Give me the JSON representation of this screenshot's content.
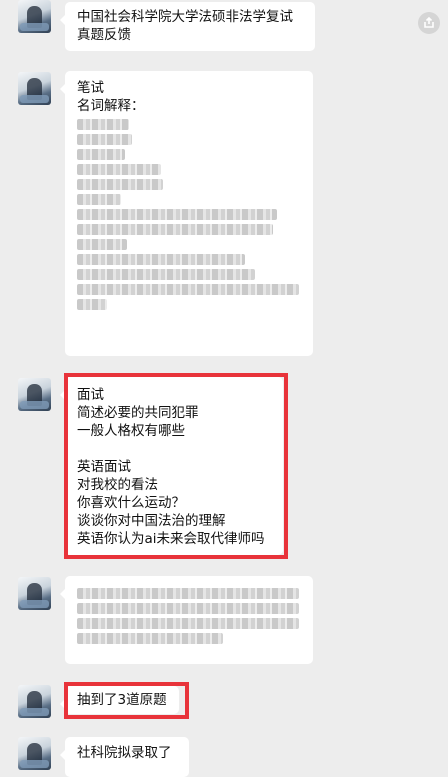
{
  "messages": [
    {
      "lines": [
        "中国社会科学院大学法硕非法学复试",
        "真题反馈"
      ]
    },
    {
      "lines": [
        "笔试",
        "名词解释："
      ]
    },
    {
      "lines": [
        "面试",
        "简述必要的共同犯罪",
        "一般人格权有哪些",
        "",
        "英语面试",
        "对我校的看法",
        "你喜欢什么运动？",
        "谈谈你对中国法治的理解",
        "英语你认为ai未来会取代律师吗"
      ]
    },
    {
      "lines": []
    },
    {
      "lines": [
        "抽到了3道原题"
      ]
    },
    {
      "lines": [
        "社科院拟录取了"
      ]
    }
  ],
  "icons": {
    "share": "export-icon",
    "avatar": "avatar-image"
  },
  "colors": {
    "background": "#ededed",
    "bubble": "#ffffff",
    "highlight": "#e8333a"
  }
}
